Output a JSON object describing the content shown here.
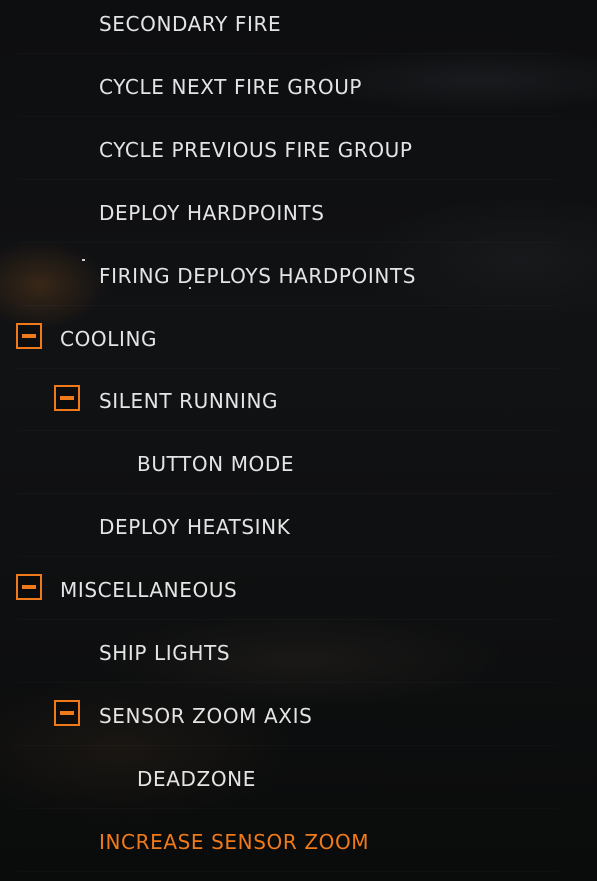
{
  "accent_color": "#f07a1a",
  "text_color": "#e4e4e4",
  "items": [
    {
      "label": "SECONDARY FIRE",
      "level": 2,
      "toggle": false
    },
    {
      "label": "CYCLE NEXT FIRE GROUP",
      "level": 2,
      "toggle": false
    },
    {
      "label": "CYCLE PREVIOUS FIRE GROUP",
      "level": 2,
      "toggle": false
    },
    {
      "label": "DEPLOY HARDPOINTS",
      "level": 2,
      "toggle": false
    },
    {
      "label": "FIRING DEPLOYS HARDPOINTS",
      "level": 2,
      "toggle": false
    },
    {
      "label": "COOLING",
      "level": 1,
      "toggle": true,
      "toggle_icon": "minus-icon"
    },
    {
      "label": "SILENT RUNNING",
      "level": 2,
      "toggle": true,
      "toggle_icon": "minus-icon"
    },
    {
      "label": "BUTTON MODE",
      "level": 3,
      "toggle": false
    },
    {
      "label": "DEPLOY HEATSINK",
      "level": 2,
      "toggle": false
    },
    {
      "label": "MISCELLANEOUS",
      "level": 1,
      "toggle": true,
      "toggle_icon": "minus-icon"
    },
    {
      "label": "SHIP LIGHTS",
      "level": 2,
      "toggle": false
    },
    {
      "label": "SENSOR ZOOM AXIS",
      "level": 2,
      "toggle": true,
      "toggle_icon": "minus-icon"
    },
    {
      "label": "DEADZONE",
      "level": 3,
      "toggle": false
    },
    {
      "label": "INCREASE SENSOR ZOOM",
      "level": 2,
      "toggle": false,
      "active": true
    }
  ]
}
